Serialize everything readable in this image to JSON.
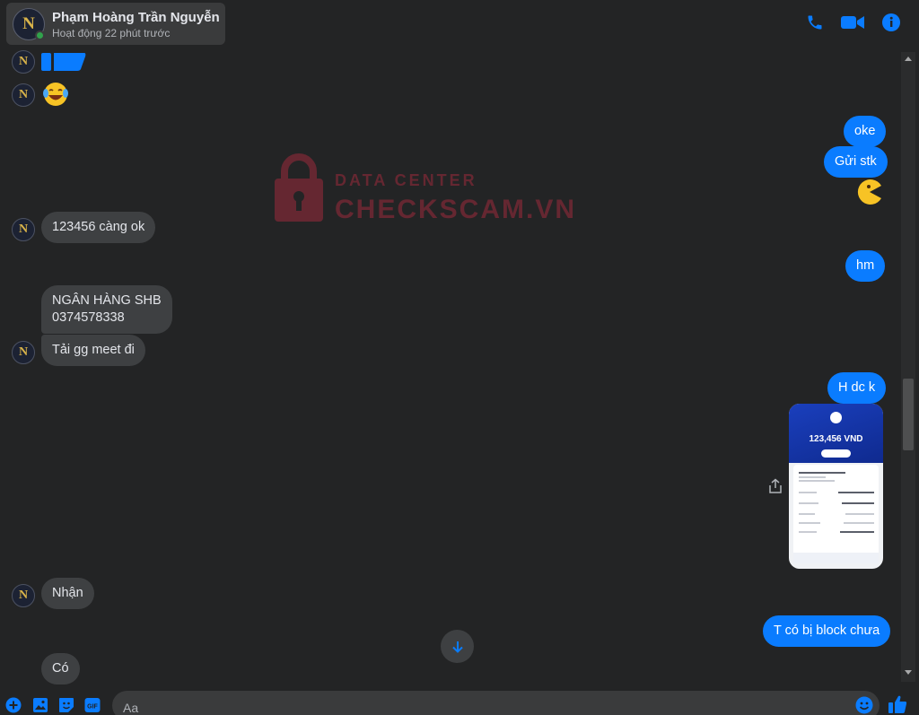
{
  "header": {
    "contact_name": "Phạm Hoàng Trần Nguyễn",
    "status": "Hoạt động 22 phút trước",
    "avatar_letter": "N",
    "actions": [
      "phone-icon",
      "video-camera-icon",
      "info-icon"
    ]
  },
  "watermark": {
    "line1": "DATA CENTER",
    "line2": "CHECKSCAM.VN"
  },
  "messages": [
    {
      "from": "contact",
      "type": "sticker",
      "icon": "thumbs-up-sticker"
    },
    {
      "from": "contact",
      "type": "emoji",
      "icon": "laughing-crying-emoji"
    },
    {
      "from": "me",
      "text": "oke"
    },
    {
      "from": "me",
      "text": "Gửi stk"
    },
    {
      "from": "me",
      "type": "emoji",
      "icon": "pacman-emoji"
    },
    {
      "from": "contact",
      "text": "123456 càng ok"
    },
    {
      "from": "me",
      "text": "hm"
    },
    {
      "from": "contact",
      "text_lines": [
        "NGÂN HÀNG SHB",
        "0374578338"
      ]
    },
    {
      "from": "contact",
      "text": "Tải gg meet đi"
    },
    {
      "from": "me",
      "text": "H dc k"
    },
    {
      "from": "me",
      "type": "image",
      "image_amount": "123,456 VND"
    },
    {
      "from": "contact",
      "text": "Nhận"
    },
    {
      "from": "me",
      "text": "T có bị block chưa"
    },
    {
      "from": "contact",
      "text": "Có"
    }
  ],
  "composer": {
    "placeholder": "Aa",
    "tools": [
      "plus-icon",
      "image-icon",
      "sticker-icon",
      "gif-icon"
    ],
    "emoji": "emoji-icon",
    "send": "thumbs-up-icon"
  },
  "colors": {
    "background": "#232425",
    "outgoing_bubble": "#0a7cff",
    "incoming_bubble": "#3e4042",
    "accent": "#0a7cff"
  }
}
